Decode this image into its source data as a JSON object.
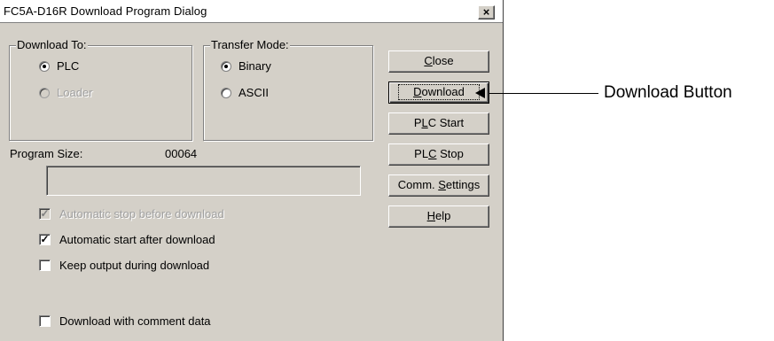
{
  "dialog": {
    "title": "FC5A-D16R Download Program Dialog",
    "close_glyph": "×"
  },
  "download_to": {
    "label": "Download To:",
    "options": [
      {
        "label": "PLC",
        "selected": true,
        "enabled": true
      },
      {
        "label": "Loader",
        "selected": false,
        "enabled": false
      }
    ]
  },
  "transfer_mode": {
    "label": "Transfer Mode:",
    "options": [
      {
        "label": "Binary",
        "selected": true
      },
      {
        "label": "ASCII",
        "selected": false
      }
    ]
  },
  "program_size": {
    "label": "Program Size:",
    "value": "00064"
  },
  "checkboxes": [
    {
      "label": "Automatic stop before download",
      "checked": true,
      "enabled": false
    },
    {
      "label": "Automatic start after download",
      "checked": true,
      "enabled": true
    },
    {
      "label": "Keep output during download",
      "checked": false,
      "enabled": true
    },
    {
      "label": "Download with comment data",
      "checked": false,
      "enabled": true
    }
  ],
  "buttons": {
    "close": {
      "mnemonic": "C",
      "rest": "lose"
    },
    "download": {
      "mnemonic": "D",
      "rest": "ownload"
    },
    "plc_start": {
      "pre": "P",
      "mnemonic": "L",
      "rest": "C Start"
    },
    "plc_stop": {
      "pre": "PL",
      "mnemonic": "C",
      "rest": " Stop"
    },
    "comm_settings": {
      "pre": "Comm. ",
      "mnemonic": "S",
      "rest": "ettings"
    },
    "help": {
      "mnemonic": "H",
      "rest": "elp"
    }
  },
  "annotation": {
    "label": "Download Button"
  },
  "colors": {
    "dialog_face": "#d4d0c8",
    "shadow": "#808080",
    "disabled_text": "#a0a0a0"
  }
}
